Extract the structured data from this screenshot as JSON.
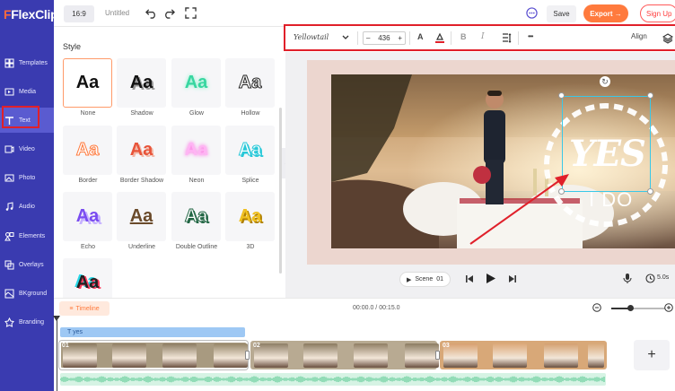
{
  "app": {
    "logo": "FlexClip"
  },
  "nav": {
    "items": [
      {
        "label": "Templates",
        "icon": "templates-icon"
      },
      {
        "label": "Media",
        "icon": "media-icon"
      },
      {
        "label": "Text",
        "icon": "text-icon"
      },
      {
        "label": "Video",
        "icon": "video-icon"
      },
      {
        "label": "Photo",
        "icon": "photo-icon"
      },
      {
        "label": "Audio",
        "icon": "audio-icon"
      },
      {
        "label": "Elements",
        "icon": "elements-icon"
      },
      {
        "label": "Overlays",
        "icon": "overlays-icon"
      },
      {
        "label": "BKground",
        "icon": "background-icon"
      },
      {
        "label": "Branding",
        "icon": "branding-icon"
      }
    ],
    "active": "Text"
  },
  "topbar": {
    "ratio": "16:9",
    "title": "Untitled",
    "save_label": "Save",
    "export_label": "Export →",
    "signup_label": "Sign Up"
  },
  "style_panel": {
    "title": "Style",
    "sample": "Aa",
    "styles": [
      {
        "label": "None"
      },
      {
        "label": "Shadow"
      },
      {
        "label": "Glow"
      },
      {
        "label": "Hollow"
      },
      {
        "label": "Border"
      },
      {
        "label": "Border Shadow"
      },
      {
        "label": "Neon"
      },
      {
        "label": "Splice"
      },
      {
        "label": "Echo"
      },
      {
        "label": "Underline"
      },
      {
        "label": "Double Outline"
      },
      {
        "label": "3D"
      },
      {
        "label": ""
      }
    ],
    "selected": "None"
  },
  "text_toolbar": {
    "font": "Yellowtail",
    "font_size": "436",
    "minus": "–",
    "plus": "+",
    "align_label": "Align",
    "more": "•••"
  },
  "canvas": {
    "overlay_text_main": "YES",
    "overlay_text_sub": "I DO"
  },
  "player": {
    "scene_label": "Scene",
    "scene_number": "01",
    "duration": "5.0s"
  },
  "timeline": {
    "tab_label": "Timeline",
    "time": "00:00.0 / 00:15.0",
    "zoom_level": 0.35,
    "text_track_label": "yes",
    "clips": [
      {
        "num": "01"
      },
      {
        "num": "02"
      },
      {
        "num": "03"
      }
    ],
    "add_label": "+"
  },
  "colors": {
    "nav_bg": "#3a3bb0",
    "accent": "#ff7a3d",
    "highlight": "#e0202a",
    "selection": "#39c8e8",
    "audio": "#d6f3e4"
  }
}
